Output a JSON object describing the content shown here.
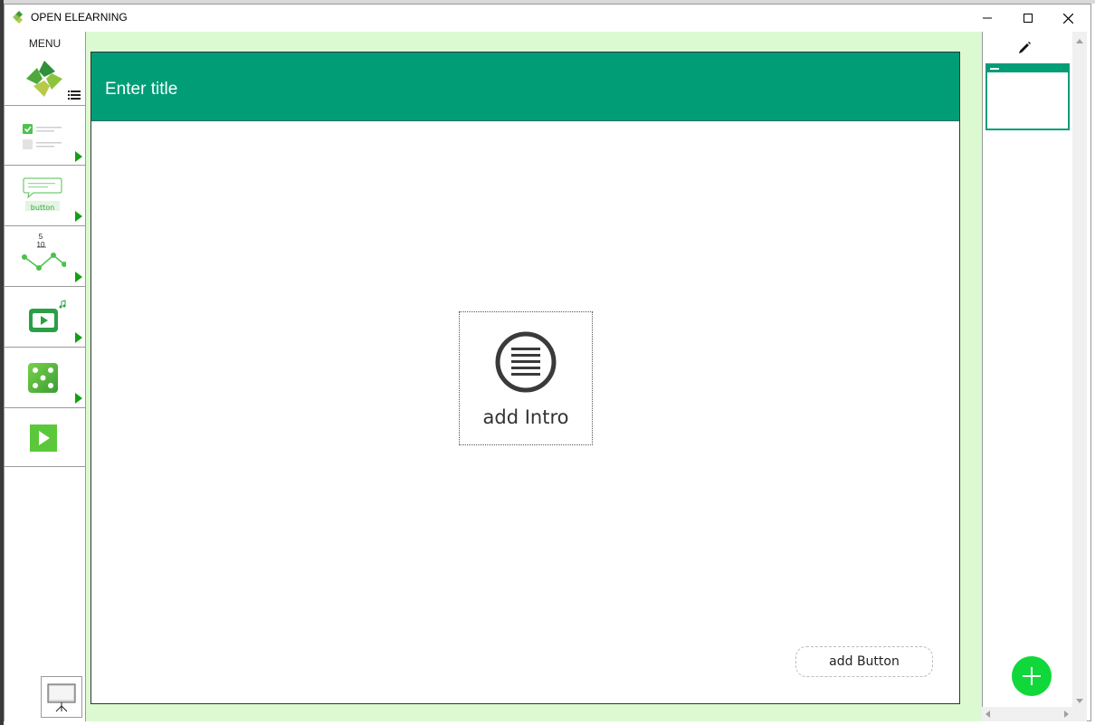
{
  "window": {
    "title": "OPEN ELEARNING",
    "controls": [
      "minimize",
      "maximize",
      "close"
    ]
  },
  "sidebar": {
    "menu_label": "MENU",
    "items": [
      {
        "icon": "checklist-icon"
      },
      {
        "icon": "speech-button-icon",
        "button_text": "button"
      },
      {
        "icon": "fraction-graph-icon",
        "num": "5",
        "den": "10"
      },
      {
        "icon": "video-music-icon"
      },
      {
        "icon": "dice-icon"
      },
      {
        "icon": "play-icon"
      }
    ]
  },
  "slide": {
    "title_placeholder": "Enter title",
    "intro_label": "add Intro",
    "button_label": "add Button"
  },
  "colors": {
    "header": "#009d77",
    "canvas_bg": "#dcfad2",
    "accent_green": "#10d83a",
    "arrow_green": "#12a012"
  }
}
